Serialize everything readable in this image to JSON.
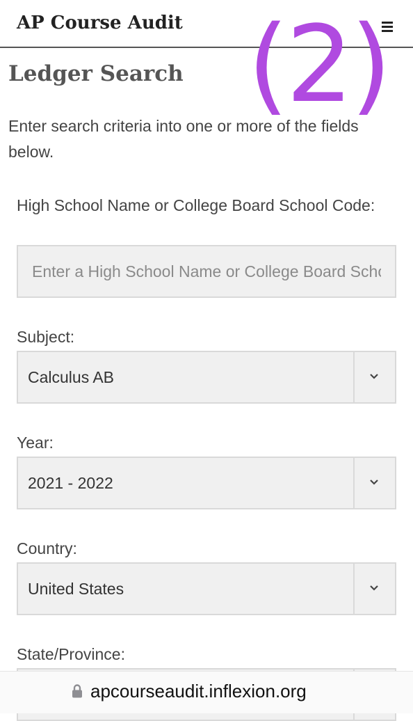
{
  "header": {
    "title": "AP Course Audit",
    "menu_icon": "hamburger-menu-icon",
    "overlay_mark": "(2)"
  },
  "page": {
    "title": "Ledger Search",
    "intro": "Enter search criteria into one or more of the fields below."
  },
  "form": {
    "school": {
      "label": "High School Name or College Board School Code:",
      "value": "",
      "placeholder": "Enter a High School Name or College Board School Code"
    },
    "subject": {
      "label": "Subject:",
      "value": "Calculus AB"
    },
    "year": {
      "label": "Year:",
      "value": "2021 - 2022"
    },
    "country": {
      "label": "Country:",
      "value": "United States"
    },
    "state": {
      "label": "State/Province:",
      "value": ""
    }
  },
  "browser": {
    "url": "apcourseaudit.inflexion.org"
  },
  "colors": {
    "overlay": "#b04ae0",
    "field_bg": "#f0f0f0",
    "field_border": "#d9d9d9"
  }
}
